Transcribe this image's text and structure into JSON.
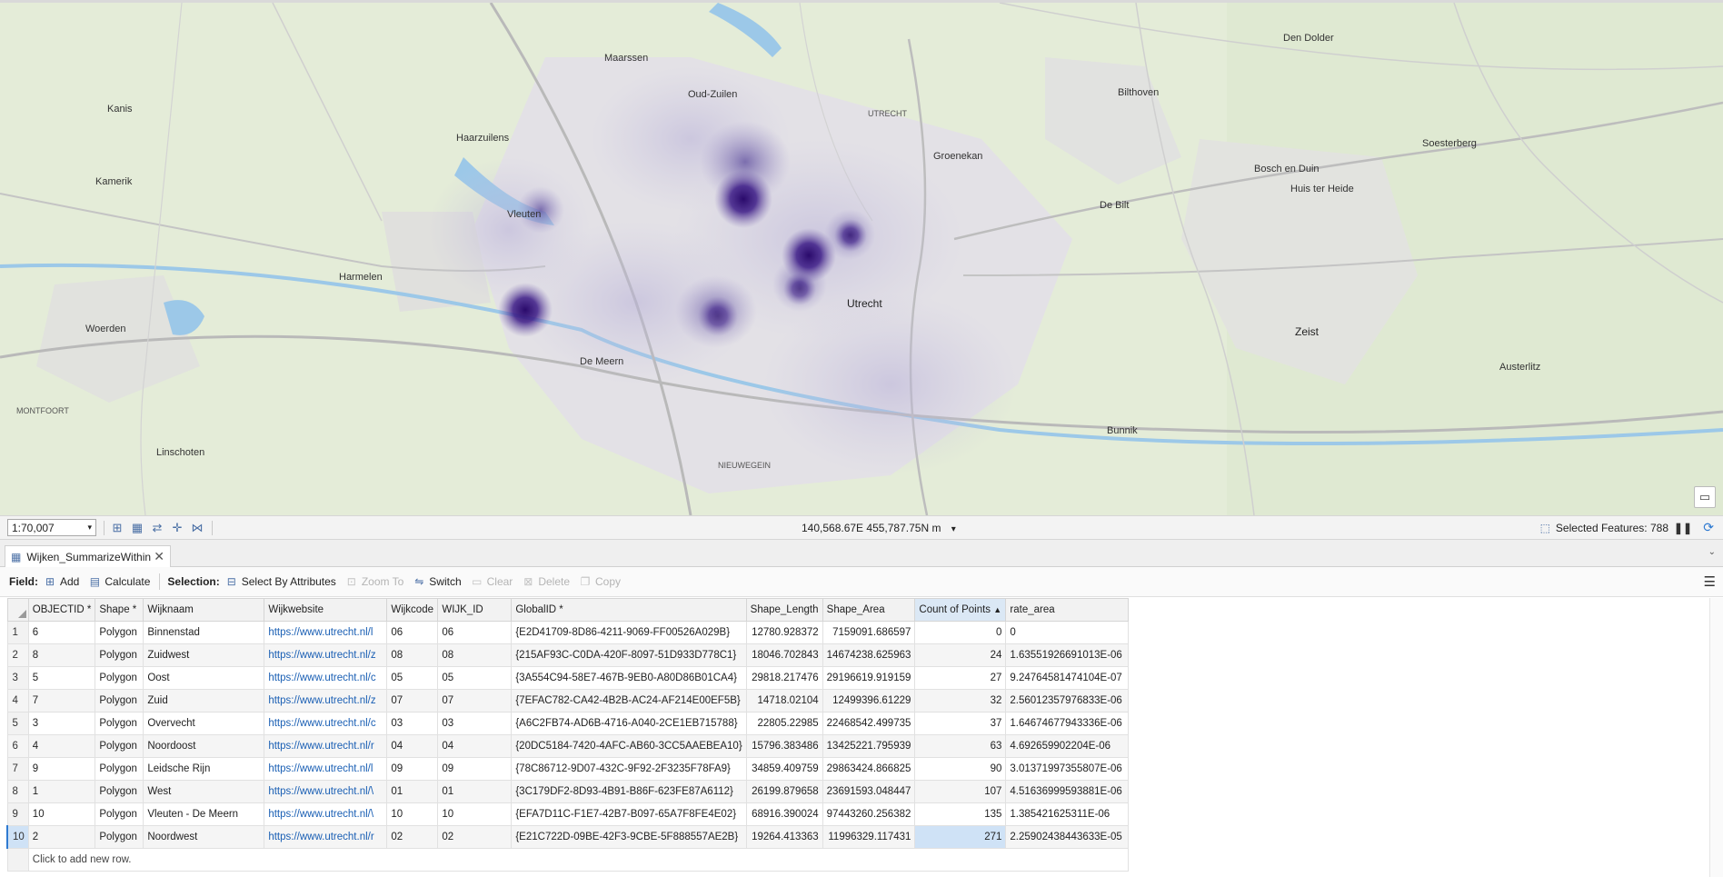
{
  "map": {
    "labels": {
      "maarssen": "Maarssen",
      "oud_zuilen": "Oud-Zuilen",
      "haarzuilens": "Haarzuilens",
      "kanis": "Kanis",
      "kamerik": "Kamerik",
      "harmelen": "Harmelen",
      "woerden": "Woerden",
      "montfoort": "MONTFOORT",
      "linschoten": "Linschoten",
      "de_meern": "De Meern",
      "utrecht": "Utrecht",
      "utrecht_caps": "UTRECHT",
      "groenekan": "Groenekan",
      "bilthoven": "Bilthoven",
      "de_bilt": "De Bilt",
      "den_dolder": "Den Dolder",
      "bosch_en_duin": "Bosch en Duin",
      "huis_ter_heide": "Huis ter Heide",
      "soesterberg": "Soesterberg",
      "zeist": "Zeist",
      "austerlitz": "Austerlitz",
      "bunnik": "Bunnik",
      "nieuwegein": "NIEUWEGEIN",
      "vleuten": "Vleuten"
    }
  },
  "statusbar": {
    "scale": "1:70,007",
    "coordinates": "140,568.67E 455,787.75N m",
    "selected_features": "Selected Features: 788"
  },
  "tab": {
    "title": "Wijken_SummarizeWithin"
  },
  "toolbar": {
    "field_label": "Field:",
    "add": "Add",
    "calculate": "Calculate",
    "selection_label": "Selection:",
    "select_by_attributes": "Select By Attributes",
    "zoom_to": "Zoom To",
    "switch": "Switch",
    "clear": "Clear",
    "delete": "Delete",
    "copy": "Copy"
  },
  "table": {
    "columns": [
      "OBJECTID *",
      "Shape *",
      "Wijknaam",
      "Wijkwebsite",
      "Wijkcode",
      "WIJK_ID",
      "GlobalID *",
      "Shape_Length",
      "Shape_Area",
      "Count of Points",
      "rate_area"
    ],
    "rows": [
      {
        "n": "1",
        "objectid": "6",
        "shape": "Polygon",
        "wijknaam": "Binnenstad",
        "web": "https://www.utrecht.nl/l",
        "code": "06",
        "wid": "06",
        "gid": "{E2D41709-8D86-4211-9069-FF00526A029B}",
        "len": "12780.928372",
        "area": "7159091.686597",
        "count": "0",
        "rate": "0"
      },
      {
        "n": "2",
        "objectid": "8",
        "shape": "Polygon",
        "wijknaam": "Zuidwest",
        "web": "https://www.utrecht.nl/z",
        "code": "08",
        "wid": "08",
        "gid": "{215AF93C-C0DA-420F-8097-51D933D778C1}",
        "len": "18046.702843",
        "area": "14674238.625963",
        "count": "24",
        "rate": "1.63551926691013E-06"
      },
      {
        "n": "3",
        "objectid": "5",
        "shape": "Polygon",
        "wijknaam": "Oost",
        "web": "https://www.utrecht.nl/c",
        "code": "05",
        "wid": "05",
        "gid": "{3A554C94-58E7-467B-9EB0-A80D86B01CA4}",
        "len": "29818.217476",
        "area": "29196619.919159",
        "count": "27",
        "rate": "9.24764581474104E-07"
      },
      {
        "n": "4",
        "objectid": "7",
        "shape": "Polygon",
        "wijknaam": "Zuid",
        "web": "https://www.utrecht.nl/z",
        "code": "07",
        "wid": "07",
        "gid": "{7EFAC782-CA42-4B2B-AC24-AF214E00EF5B}",
        "len": "14718.02104",
        "area": "12499396.61229",
        "count": "32",
        "rate": "2.56012357976833E-06"
      },
      {
        "n": "5",
        "objectid": "3",
        "shape": "Polygon",
        "wijknaam": "Overvecht",
        "web": "https://www.utrecht.nl/c",
        "code": "03",
        "wid": "03",
        "gid": "{A6C2FB74-AD6B-4716-A040-2CE1EB715788}",
        "len": "22805.22985",
        "area": "22468542.499735",
        "count": "37",
        "rate": "1.64674677943336E-06"
      },
      {
        "n": "6",
        "objectid": "4",
        "shape": "Polygon",
        "wijknaam": "Noordoost",
        "web": "https://www.utrecht.nl/r",
        "code": "04",
        "wid": "04",
        "gid": "{20DC5184-7420-4AFC-AB60-3CC5AAEBEA10}",
        "len": "15796.383486",
        "area": "13425221.795939",
        "count": "63",
        "rate": "4.692659902204E-06"
      },
      {
        "n": "7",
        "objectid": "9",
        "shape": "Polygon",
        "wijknaam": "Leidsche Rijn",
        "web": "https://www.utrecht.nl/l",
        "code": "09",
        "wid": "09",
        "gid": "{78C86712-9D07-432C-9F92-2F3235F78FA9}",
        "len": "34859.409759",
        "area": "29863424.866825",
        "count": "90",
        "rate": "3.01371997355807E-06"
      },
      {
        "n": "8",
        "objectid": "1",
        "shape": "Polygon",
        "wijknaam": "West",
        "web": "https://www.utrecht.nl/\\",
        "code": "01",
        "wid": "01",
        "gid": "{3C179DF2-8D93-4B91-B86F-623FE87A6112}",
        "len": "26199.879658",
        "area": "23691593.048447",
        "count": "107",
        "rate": "4.51636999593881E-06"
      },
      {
        "n": "9",
        "objectid": "10",
        "shape": "Polygon",
        "wijknaam": "Vleuten - De Meern",
        "web": "https://www.utrecht.nl/\\",
        "code": "10",
        "wid": "10",
        "gid": "{EFA7D11C-F1E7-42B7-B097-65A7F8FE4E02}",
        "len": "68916.390024",
        "area": "97443260.256382",
        "count": "135",
        "rate": "1.385421625311E-06"
      },
      {
        "n": "10",
        "objectid": "2",
        "shape": "Polygon",
        "wijknaam": "Noordwest",
        "web": "https://www.utrecht.nl/r",
        "code": "02",
        "wid": "02",
        "gid": "{E21C722D-09BE-42F3-9CBE-5F888557AE2B}",
        "len": "19264.413363",
        "area": "11996329.117431",
        "count": "271",
        "rate": "2.25902438443633E-05"
      }
    ],
    "add_row": "Click to add new row."
  }
}
